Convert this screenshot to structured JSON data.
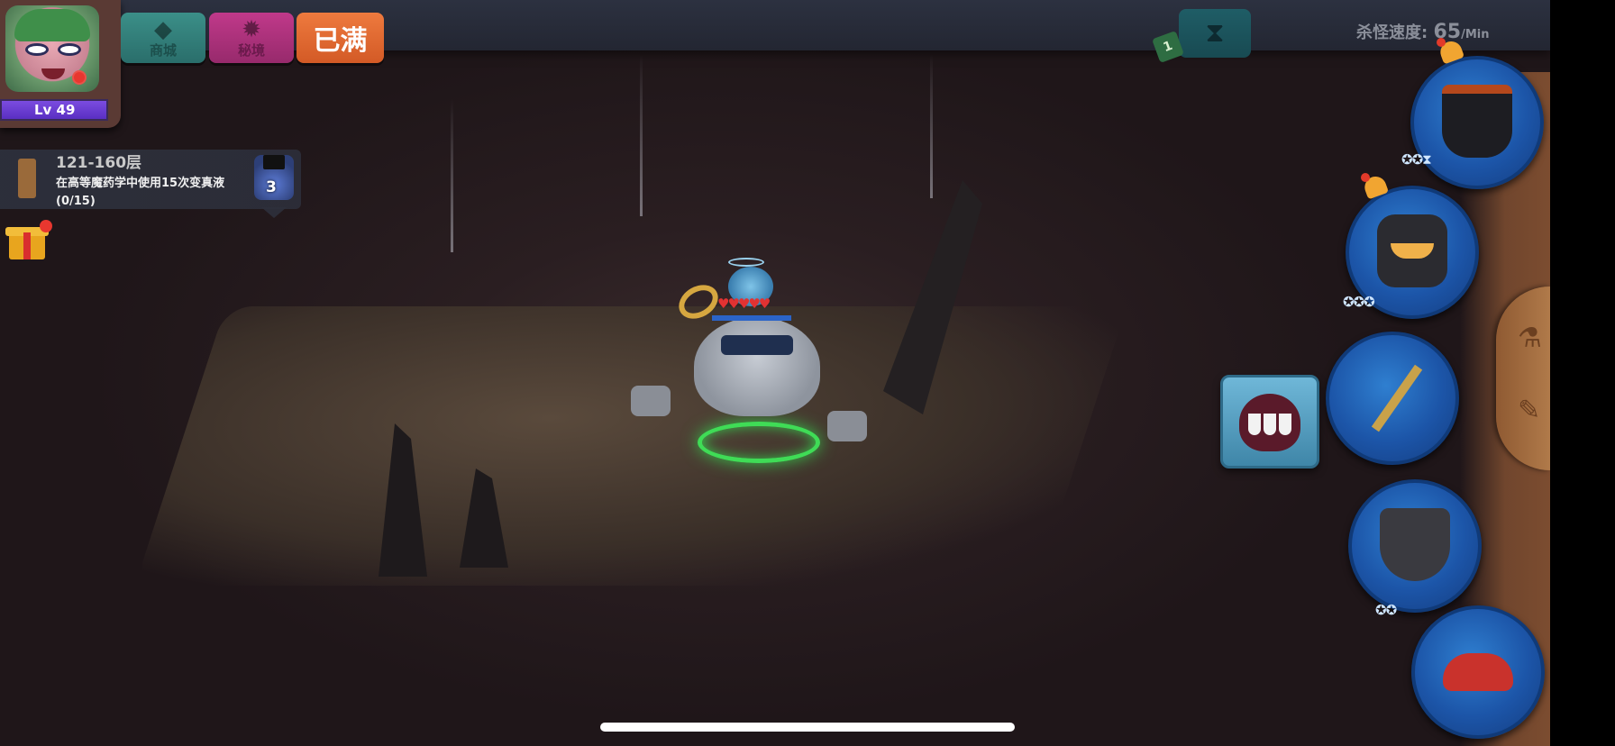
{
  "player": {
    "level_label": "Lv 49"
  },
  "top_buttons": {
    "shop": "商城",
    "secret_realm": "秘境",
    "full": "已满"
  },
  "quest": {
    "floor_range": "121-160层",
    "description": "在高等魔药学中使用15次变真液(0/15)",
    "npc_badge": "3"
  },
  "status": {
    "kill_speed_label": "杀怪速度:",
    "kill_speed_value": "65",
    "kill_speed_unit": "/Min",
    "hourglass_tag": "1"
  },
  "equipment": {
    "slots": [
      "crown",
      "armor",
      "staff",
      "cloak",
      "boots"
    ],
    "crown_stars": "✪✪⧗",
    "armor_stars": "✪✪✪",
    "cloak_stars": "✪✪"
  },
  "icons": {
    "shop": "gem-icon",
    "secret_realm": "demon-icon",
    "gift": "gift-icon",
    "hourglass": "hourglass-icon",
    "alert": "bell-icon",
    "skill": "fangs-icon",
    "side_tab": [
      "potion-icon",
      "scroll-icon"
    ]
  },
  "colors": {
    "shop_button": "#2a6e6b",
    "secret_button": "#972a6c",
    "full_button": "#d35a26",
    "level_bar": "#5a2fc2",
    "equipment_slot": "#1c55a8",
    "magic_ring": "#3fdc56"
  }
}
